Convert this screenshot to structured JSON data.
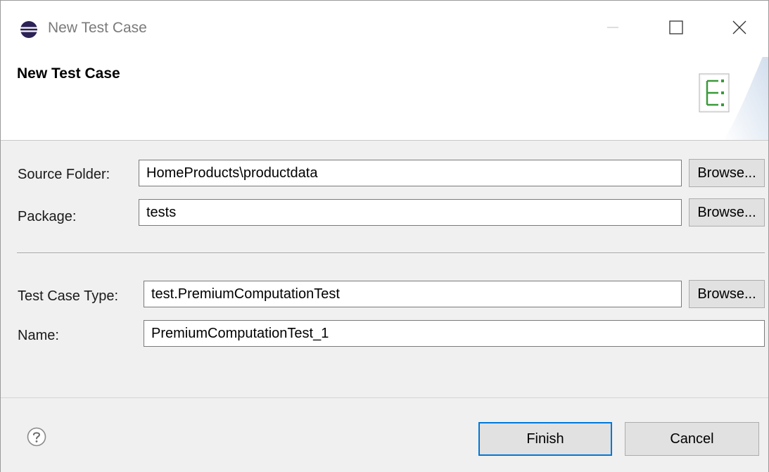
{
  "window": {
    "title": "New Test Case",
    "controls": {
      "minimize": "minimize-icon",
      "maximize": "maximize-icon",
      "close": "close-icon"
    }
  },
  "banner": {
    "title": "New Test Case",
    "graphic": "test-case-wizard-icon"
  },
  "form": {
    "source_folder": {
      "label": "Source Folder:",
      "value": "HomeProducts\\productdata",
      "browse_label": "Browse..."
    },
    "package": {
      "label": "Package:",
      "value": "tests",
      "browse_label": "Browse..."
    },
    "test_case_type": {
      "label": "Test Case Type:",
      "value": "test.PremiumComputationTest",
      "browse_label": "Browse..."
    },
    "name": {
      "label": "Name:",
      "value": "PremiumComputationTest_1"
    }
  },
  "footer": {
    "help_icon": "help-icon",
    "finish_label": "Finish",
    "cancel_label": "Cancel"
  },
  "colors": {
    "dialog_background": "#f0f0f0",
    "button_face": "#e1e1e1",
    "default_button_border": "#0078d7",
    "banner_icon_green": "#3a9a3a",
    "app_icon_navy": "#2c2255"
  }
}
